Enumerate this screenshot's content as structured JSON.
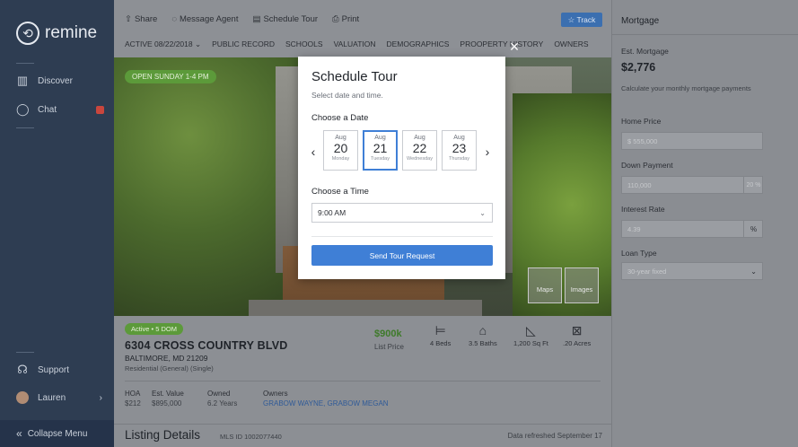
{
  "sidebar": {
    "logo": "remine",
    "items": [
      {
        "label": "Discover",
        "icon": "map-icon"
      },
      {
        "label": "Chat",
        "icon": "chat-icon"
      }
    ],
    "support_label": "Support",
    "user_label": "Lauren",
    "user_chevron": "›",
    "collapse_label": "Collapse Menu"
  },
  "toolbar": {
    "share_label": "Share",
    "message_label": "Message Agent",
    "schedule_label": "Schedule Tour",
    "print_label": "Print",
    "track_label": "☆ Track"
  },
  "tabs": [
    "ACTIVE 08/22/2018 ⌄",
    "PUBLIC RECORD",
    "SCHOOLS",
    "VALUATION",
    "DEMOGRAPHICS",
    "PROOPERTY HISTORY",
    "OWNERS"
  ],
  "photo": {
    "open_house": "OPEN SUNDAY 1-4 PM",
    "thumb_maps": "Maps",
    "thumb_images": "Images"
  },
  "listing": {
    "status": "Active • 5 DOM",
    "address": "6304 CROSS COUNTRY BLVD",
    "city": "BALTIMORE, MD 21209",
    "type": "Residential (General) (Single)",
    "price": "$900k",
    "price_label": "List Price",
    "beds": "4 Beds",
    "baths": "3.5 Baths",
    "sqft": "1,200 Sq Ft",
    "acres": ".20 Acres",
    "hoa_label": "HOA",
    "hoa_value": "$212",
    "est_label": "Est. Value",
    "est_value": "$895,000",
    "owned_label": "Owned",
    "owned_value": "6.2 Years",
    "owners_label": "Owners",
    "owners_value": "GRABOW WAYNE, GRABOW MEGAN",
    "details_title": "Listing Details",
    "mls": "MLS ID 1002077440",
    "refreshed": "Data refreshed September 17"
  },
  "mortgage": {
    "title": "Mortgage",
    "est_label": "Est. Mortgage",
    "est_value": "$2,776",
    "subtitle": "Calculate your monthly mortgage payments",
    "home_price_label": "Home Price",
    "home_price_value": "$   555,000",
    "down_label": "Down Payment",
    "down_value": "110,000",
    "down_pct": "20 %",
    "rate_label": "Interest Rate",
    "rate_value": "4.39",
    "rate_unit": "%",
    "loan_label": "Loan Type",
    "loan_value": "30-year fixed"
  },
  "modal": {
    "title": "Schedule Tour",
    "subtitle": "Select date and time.",
    "date_label": "Choose a Date",
    "dates": [
      {
        "mo": "Aug",
        "day": "20",
        "dow": "Monday"
      },
      {
        "mo": "Aug",
        "day": "21",
        "dow": "Tuesday"
      },
      {
        "mo": "Aug",
        "day": "22",
        "dow": "Wednesday"
      },
      {
        "mo": "Aug",
        "day": "23",
        "dow": "Thursday"
      }
    ],
    "time_label": "Choose a Time",
    "time_value": "9:00 AM",
    "send_label": "Send Tour Request",
    "close_glyph": "×",
    "prev_glyph": "‹",
    "next_glyph": "›"
  }
}
